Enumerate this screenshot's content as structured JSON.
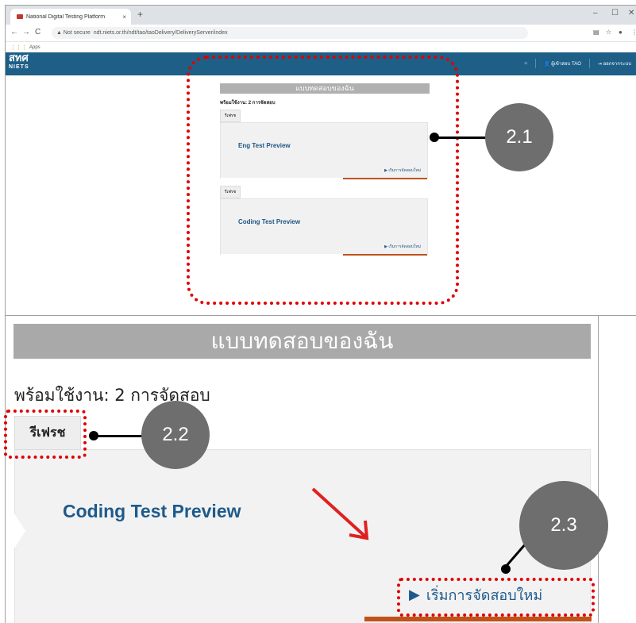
{
  "browser": {
    "tab_title": "National Digital Testing Platform",
    "tab_close": "×",
    "new_tab": "+",
    "url_warning": "▲ Not secure",
    "url": "ndt.niets.or.th/ndt/tao/taoDelivery/DeliveryServer/index",
    "bookmarks_label": "Apps",
    "window_controls": [
      "–",
      "☐",
      "✕"
    ]
  },
  "app": {
    "logo_main": "สทศ",
    "logo_sub": "NIETS",
    "header_user": "ผู้เข้าสอบ TAO",
    "header_logout": "ออกจากระบบ"
  },
  "mini": {
    "heading": "แบบทดสอบของฉัน",
    "count": "พร้อมใช้งาน: 2 การจัดสอบ",
    "refresh": "รีเฟรช",
    "tests": [
      {
        "title": "Eng Test Preview",
        "start": "▶ เริ่มการจัดสอบใหม่"
      },
      {
        "title": "Coding Test Preview",
        "start": "▶ เริ่มการจัดสอบใหม่"
      }
    ]
  },
  "zoom": {
    "heading": "แบบทดสอบของฉัน",
    "count": "พร้อมใช้งาน: 2 การจัดสอบ",
    "refresh": "รีเฟรช",
    "test_title": "Coding Test Preview",
    "start_icon": "▶",
    "start_label": "เริ่มการจัดสอบใหม่"
  },
  "annotations": {
    "callout_1": "2.1",
    "callout_2": "2.2",
    "callout_3": "2.3",
    "highlight_color": "#e00000",
    "circle_color": "#6e6e6e"
  }
}
